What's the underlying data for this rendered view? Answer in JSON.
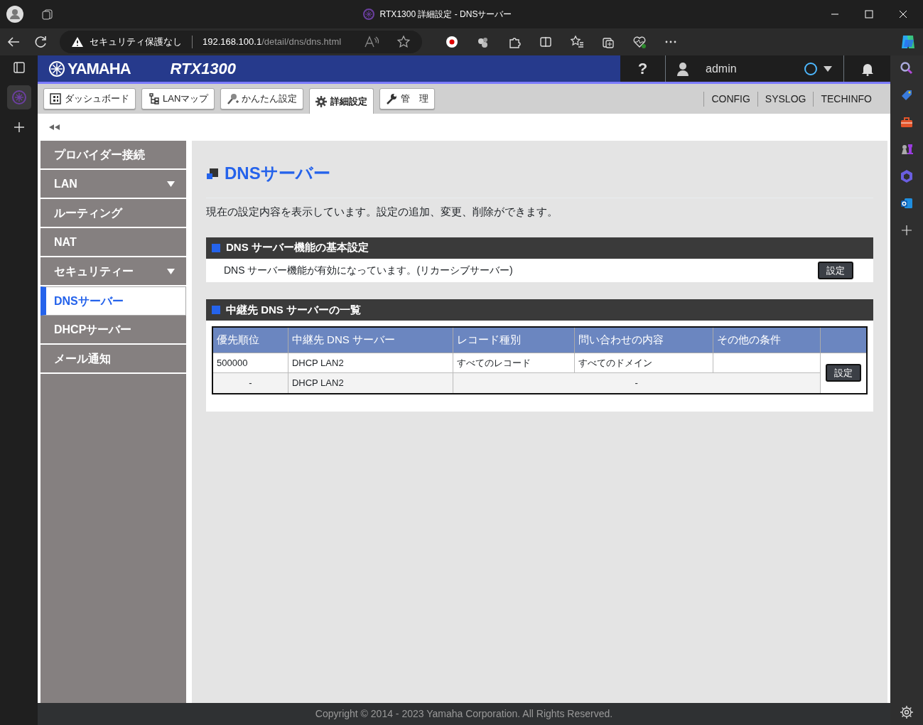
{
  "browser": {
    "title": "RTX1300 詳細設定 - DNSサーバー",
    "security": "セキュリティ保護なし",
    "url_host": "192.168.100.1",
    "url_path": "/detail/dns/dns.html"
  },
  "header": {
    "logo": "YAMAHA",
    "model": "RTX1300",
    "help": "?",
    "user": "admin"
  },
  "tabs": [
    {
      "label": "ダッシュボード",
      "selected": false
    },
    {
      "label": "LANマップ",
      "selected": false
    },
    {
      "label": "かんたん設定",
      "selected": false
    },
    {
      "label": "詳細設定",
      "selected": true
    },
    {
      "label": "管　理",
      "selected": false
    }
  ],
  "links": [
    "CONFIG",
    "SYSLOG",
    "TECHINFO"
  ],
  "menu": [
    {
      "label": "プロバイダー接続",
      "expandable": false,
      "selected": false
    },
    {
      "label": "LAN",
      "expandable": true,
      "selected": false
    },
    {
      "label": "ルーティング",
      "expandable": false,
      "selected": false
    },
    {
      "label": "NAT",
      "expandable": false,
      "selected": false
    },
    {
      "label": "セキュリティー",
      "expandable": true,
      "selected": false
    },
    {
      "label": "DNSサーバー",
      "expandable": false,
      "selected": true
    },
    {
      "label": "DHCPサーバー",
      "expandable": false,
      "selected": false
    },
    {
      "label": "メール通知",
      "expandable": false,
      "selected": false
    }
  ],
  "page": {
    "title": "DNSサーバー",
    "description": "現在の設定内容を表示しています。設定の追加、変更、削除ができます。"
  },
  "basic": {
    "heading": "DNS サーバー機能の基本設定",
    "status": "DNS サーバー機能が有効になっています。(リカーシブサーバー)",
    "button": "設定"
  },
  "relay": {
    "heading": "中継先 DNS サーバーの一覧",
    "columns": [
      "優先順位",
      "中継先 DNS サーバー",
      "レコード種別",
      "問い合わせの内容",
      "その他の条件"
    ],
    "rows": [
      {
        "cells": [
          {
            "text": "500000"
          },
          {
            "text": "DHCP LAN2"
          },
          {
            "text": "すべてのレコード"
          },
          {
            "text": "すべてのドメイン"
          }
        ]
      },
      {
        "cells": [
          {
            "text": "-"
          },
          {
            "text": "DHCP LAN2"
          },
          {
            "text": "-",
            "colspan": 3
          }
        ]
      }
    ],
    "button": "設定"
  },
  "footer": "Copyright © 2014 - 2023 Yamaha Corporation. All Rights Reserved."
}
